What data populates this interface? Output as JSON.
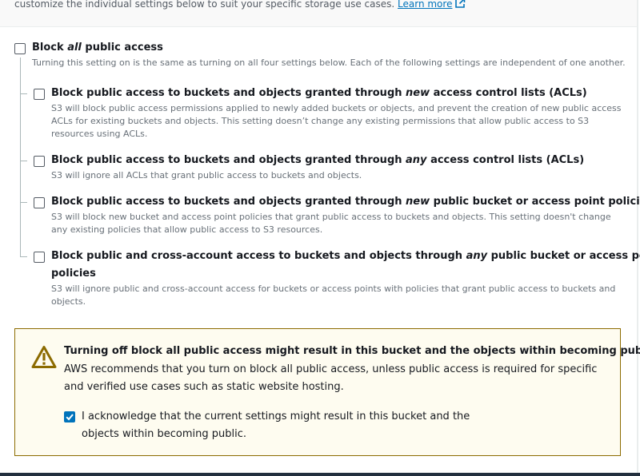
{
  "intro": {
    "text": "customize the individual settings below to suit your specific storage use cases.",
    "learn_more": "Learn more"
  },
  "block_all": {
    "label_pre": "Block ",
    "label_em": "all",
    "label_post": " public access",
    "description": "Turning this setting on is the same as turning on all four settings below. Each of the following settings are independent of one another.",
    "checked": false
  },
  "settings": [
    {
      "label_pre": "Block public access to buckets and objects granted through ",
      "label_em": "new",
      "label_post": " access control lists (ACLs)",
      "description": "S3 will block public access permissions applied to newly added buckets or objects, and prevent the creation of new public access ACLs for existing buckets and objects. This setting doesn’t change any existing permissions that allow public access to S3 resources using ACLs.",
      "checked": false
    },
    {
      "label_pre": "Block public access to buckets and objects granted through ",
      "label_em": "any",
      "label_post": " access control lists (ACLs)",
      "description": "S3 will ignore all ACLs that grant public access to buckets and objects.",
      "checked": false
    },
    {
      "label_pre": "Block public access to buckets and objects granted through ",
      "label_em": "new",
      "label_post": " public bucket or access point policies",
      "description": "S3 will block new bucket and access point policies that grant public access to buckets and objects. This setting doesn't change any existing policies that allow public access to S3 resources.",
      "checked": false
    },
    {
      "label_pre": "Block public and cross-account access to buckets and objects through ",
      "label_em": "any",
      "label_post": " public bucket or access point",
      "label_line2": "policies",
      "description": "S3 will ignore public and cross-account access for buckets or access points with policies that grant public access to buckets and objects.",
      "checked": false
    }
  ],
  "warning": {
    "icon": "warning-triangle-icon",
    "title": "Turning off block all public access might result in this bucket and the objects within becoming public",
    "body": "AWS recommends that you turn on block all public access, unless public access is required for specific and verified use cases such as static website hosting.",
    "acknowledge_label": "I acknowledge that the current settings might result in this bucket and the objects within becoming public.",
    "acknowledge_checked": true
  },
  "colors": {
    "link": "#0073bb",
    "warning_border": "#8c6b00",
    "warning_bg": "#fefcf0",
    "checkbox_checked": "#0073bb"
  }
}
